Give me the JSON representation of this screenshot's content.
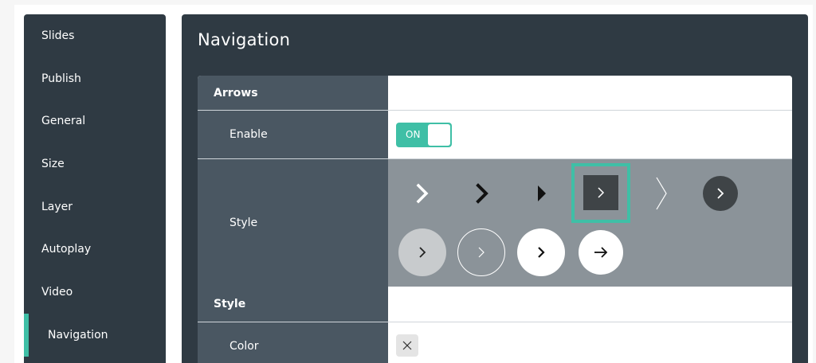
{
  "sidebar": {
    "items": [
      {
        "label": "Slides"
      },
      {
        "label": "Publish"
      },
      {
        "label": "General"
      },
      {
        "label": "Size"
      },
      {
        "label": "Layer"
      },
      {
        "label": "Autoplay"
      },
      {
        "label": "Video"
      },
      {
        "label": "Navigation",
        "active": true
      }
    ]
  },
  "main": {
    "title": "Navigation",
    "sections": {
      "arrows_label": "Arrows",
      "enable_label": "Enable",
      "enable_toggle": "ON",
      "style_label": "Style",
      "style_section_label": "Style",
      "color_label": "Color"
    },
    "arrow_styles": [
      "chevron-white-icon",
      "chevron-black-bold-icon",
      "triangle-black-icon",
      "chevron-dark-square-icon",
      "thin-chevron-white-icon",
      "chevron-dark-circle-icon",
      "chevron-light-circle-icon",
      "chevron-outline-circle-icon",
      "chevron-white-circle-icon",
      "arrow-white-circle-icon"
    ],
    "selected_style_index": 3
  },
  "colors": {
    "accent": "#3fbfa6",
    "sidebar_bg": "#2f3a43",
    "label_bg": "#4a5762",
    "style_bg": "#8b9399"
  }
}
